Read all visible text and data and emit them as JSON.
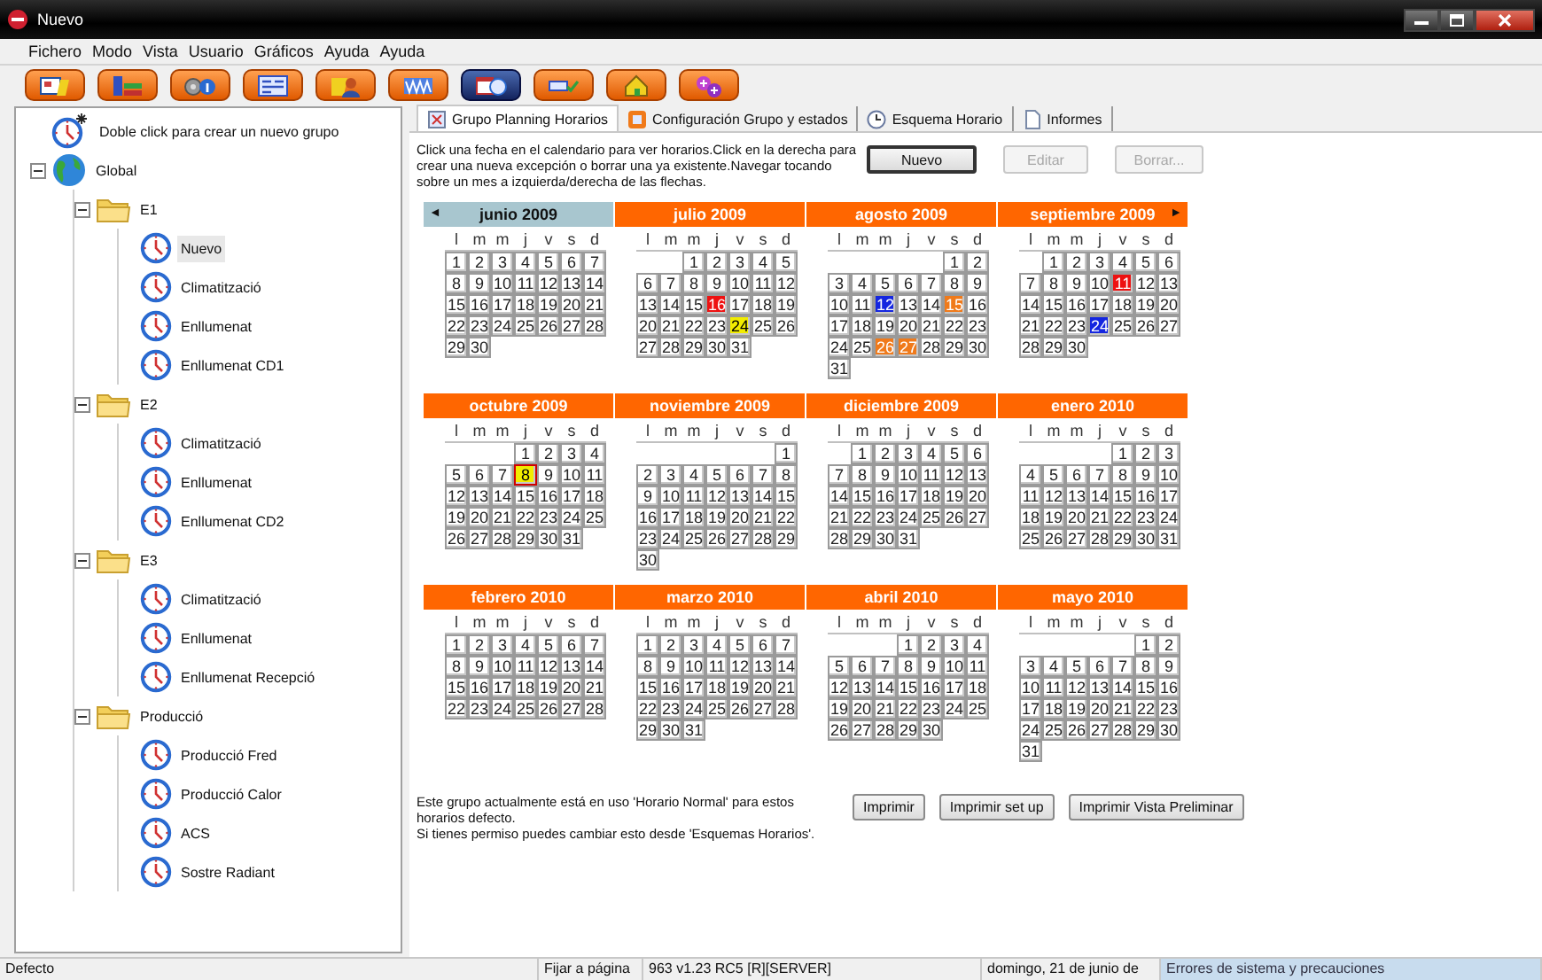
{
  "window": {
    "title": "Nuevo"
  },
  "menu": [
    "Fichero",
    "Modo",
    "Vista",
    "Usuario",
    "Gráficos",
    "Ayuda",
    "Ayuda"
  ],
  "toolbar": [
    {
      "selected": false
    },
    {
      "selected": false
    },
    {
      "selected": false
    },
    {
      "selected": false
    },
    {
      "selected": false
    },
    {
      "selected": false
    },
    {
      "selected": true
    },
    {
      "selected": false
    },
    {
      "selected": false
    },
    {
      "selected": false
    }
  ],
  "tree": {
    "items": [
      {
        "label": "Doble click para crear un nuevo grupo",
        "kind": "new",
        "selected": false
      },
      {
        "label": "Global",
        "kind": "globe",
        "selected": false,
        "expanded": true,
        "children": [
          {
            "label": "E1",
            "kind": "folder",
            "selected": false,
            "expanded": true,
            "children": [
              {
                "label": "Nuevo",
                "kind": "schedule",
                "selected": true
              },
              {
                "label": "Climatització",
                "kind": "schedule",
                "selected": false
              },
              {
                "label": "Enllumenat",
                "kind": "schedule",
                "selected": false
              },
              {
                "label": "Enllumenat CD1",
                "kind": "schedule",
                "selected": false
              }
            ]
          },
          {
            "label": "E2",
            "kind": "folder",
            "selected": false,
            "expanded": true,
            "children": [
              {
                "label": "Climatització",
                "kind": "schedule",
                "selected": false
              },
              {
                "label": "Enllumenat",
                "kind": "schedule",
                "selected": false
              },
              {
                "label": "Enllumenat CD2",
                "kind": "schedule",
                "selected": false
              }
            ]
          },
          {
            "label": "E3",
            "kind": "folder",
            "selected": false,
            "expanded": true,
            "children": [
              {
                "label": "Climatització",
                "kind": "schedule",
                "selected": false
              },
              {
                "label": "Enllumenat",
                "kind": "schedule",
                "selected": false
              },
              {
                "label": "Enllumenat Recepció",
                "kind": "schedule",
                "selected": false
              }
            ]
          },
          {
            "label": "Producció",
            "kind": "folder",
            "selected": false,
            "expanded": true,
            "children": [
              {
                "label": "Producció Fred",
                "kind": "schedule",
                "selected": false
              },
              {
                "label": "Producció Calor",
                "kind": "schedule",
                "selected": false
              },
              {
                "label": "ACS",
                "kind": "schedule",
                "selected": false
              },
              {
                "label": "Sostre Radiant",
                "kind": "schedule",
                "selected": false
              }
            ]
          }
        ]
      }
    ]
  },
  "tabs": [
    {
      "label": "Grupo Planning Horarios",
      "selected": true
    },
    {
      "label": "Configuración Grupo y estados",
      "selected": false
    },
    {
      "label": "Esquema Horario",
      "selected": false
    },
    {
      "label": "Informes",
      "selected": false
    }
  ],
  "instructions": "Click una fecha en el calendario para ver horarios.Click en la derecha para crear una nueva excepción o borrar una ya existente.Navegar tocando sobre un mes a izquierda/derecha de las flechas.",
  "actions": [
    {
      "label": "Nuevo",
      "disabled": false
    },
    {
      "label": "Editar",
      "disabled": true
    },
    {
      "label": "Borrar...",
      "disabled": true
    }
  ],
  "calendar": {
    "months": [
      {
        "title": "junio 2009",
        "selected": true,
        "arrow_left": "◄",
        "weekdays": [
          "l",
          "m",
          "m",
          "j",
          "v",
          "s",
          "d"
        ],
        "weeks": [
          [
            "1",
            "2",
            "3",
            "4",
            "5",
            "6",
            "7"
          ],
          [
            "8",
            "9",
            "10",
            "11",
            "12",
            "13",
            "14"
          ],
          [
            "15",
            "16",
            "17",
            "18",
            "19",
            "20",
            "21"
          ],
          [
            "22",
            "23",
            "24",
            "25",
            "26",
            "27",
            "28"
          ],
          [
            "29",
            "30"
          ]
        ]
      },
      {
        "title": "julio 2009",
        "selected": false,
        "weekdays": [
          "l",
          "m",
          "m",
          "j",
          "v",
          "s",
          "d"
        ],
        "weeks": [
          [
            "1",
            "2",
            "3",
            "4",
            "5"
          ],
          [
            "6",
            "7",
            "8",
            "9",
            "10",
            "11",
            "12"
          ],
          [
            "13",
            "14",
            "15",
            {
              "text": "16",
              "color": "#ee1111"
            },
            "17",
            "18",
            "19"
          ],
          [
            "20",
            "21",
            "22",
            "23",
            {
              "text": "24",
              "color": "#f2ec00"
            },
            "25",
            "26"
          ],
          [
            "27",
            "28",
            "29",
            "30",
            "31"
          ]
        ]
      },
      {
        "title": "agosto 2009",
        "selected": false,
        "weekdays": [
          "l",
          "m",
          "m",
          "j",
          "v",
          "s",
          "d"
        ],
        "weeks": [
          [
            "1",
            "2"
          ],
          [
            "3",
            "4",
            "5",
            "6",
            "7",
            "8",
            "9"
          ],
          [
            "10",
            "11",
            {
              "text": "12",
              "color": "#1426e0"
            },
            "13",
            "14",
            {
              "text": "15",
              "color": "#f07a1a"
            },
            "16"
          ],
          [
            "17",
            "18",
            "19",
            "20",
            "21",
            "22",
            "23"
          ],
          [
            "24",
            "25",
            {
              "text": "26",
              "color": "#f07a1a"
            },
            {
              "text": "27",
              "color": "#f07a1a"
            },
            "28",
            "29",
            "30"
          ],
          [
            "31"
          ]
        ]
      },
      {
        "title": "septiembre 2009",
        "selected": false,
        "arrow_right": "►",
        "weekdays": [
          "l",
          "m",
          "m",
          "j",
          "v",
          "s",
          "d"
        ],
        "weeks": [
          [
            "1",
            "2",
            "3",
            "4",
            "5",
            "6"
          ],
          [
            "7",
            "8",
            "9",
            "10",
            {
              "text": "11",
              "color": "#ee1111"
            },
            "12",
            "13"
          ],
          [
            "14",
            "15",
            "16",
            "17",
            "18",
            "19",
            "20"
          ],
          [
            "21",
            "22",
            "23",
            {
              "text": "24",
              "color": "#1426e0"
            },
            "25",
            "26",
            "27"
          ],
          [
            "28",
            "29",
            "30"
          ]
        ]
      },
      {
        "title": "octubre 2009",
        "selected": false,
        "weekdays": [
          "l",
          "m",
          "m",
          "j",
          "v",
          "s",
          "d"
        ],
        "weeks": [
          [
            "1",
            "2",
            "3",
            "4"
          ],
          [
            "5",
            "6",
            "7",
            {
              "text": "8",
              "color": "#f2ec00",
              "outlined": true
            },
            "9",
            "10",
            "11"
          ],
          [
            "12",
            "13",
            "14",
            "15",
            "16",
            "17",
            "18"
          ],
          [
            "19",
            "20",
            "21",
            "22",
            "23",
            "24",
            "25"
          ],
          [
            "26",
            "27",
            "28",
            "29",
            "30",
            "31"
          ]
        ]
      },
      {
        "title": "noviembre 2009",
        "selected": false,
        "weekdays": [
          "l",
          "m",
          "m",
          "j",
          "v",
          "s",
          "d"
        ],
        "weeks": [
          [
            "1"
          ],
          [
            "2",
            "3",
            "4",
            "5",
            "6",
            "7",
            "8"
          ],
          [
            "9",
            "10",
            "11",
            "12",
            "13",
            "14",
            "15"
          ],
          [
            "16",
            "17",
            "18",
            "19",
            "20",
            "21",
            "22"
          ],
          [
            "23",
            "24",
            "25",
            "26",
            "27",
            "28",
            "29"
          ],
          [
            "30"
          ]
        ]
      },
      {
        "title": "diciembre 2009",
        "selected": false,
        "weekdays": [
          "l",
          "m",
          "m",
          "j",
          "v",
          "s",
          "d"
        ],
        "weeks": [
          [
            "1",
            "2",
            "3",
            "4",
            "5",
            "6"
          ],
          [
            "7",
            "8",
            "9",
            "10",
            "11",
            "12",
            "13"
          ],
          [
            "14",
            "15",
            "16",
            "17",
            "18",
            "19",
            "20"
          ],
          [
            "21",
            "22",
            "23",
            "24",
            "25",
            "26",
            "27"
          ],
          [
            "28",
            "29",
            "30",
            "31"
          ]
        ]
      },
      {
        "title": "enero 2010",
        "selected": false,
        "weekdays": [
          "l",
          "m",
          "m",
          "j",
          "v",
          "s",
          "d"
        ],
        "weeks": [
          [
            "1",
            "2",
            "3"
          ],
          [
            "4",
            "5",
            "6",
            "7",
            "8",
            "9",
            "10"
          ],
          [
            "11",
            "12",
            "13",
            "14",
            "15",
            "16",
            "17"
          ],
          [
            "18",
            "19",
            "20",
            "21",
            "22",
            "23",
            "24"
          ],
          [
            "25",
            "26",
            "27",
            "28",
            "29",
            "30",
            "31"
          ]
        ]
      },
      {
        "title": "febrero 2010",
        "selected": false,
        "weekdays": [
          "l",
          "m",
          "m",
          "j",
          "v",
          "s",
          "d"
        ],
        "weeks": [
          [
            "1",
            "2",
            "3",
            "4",
            "5",
            "6",
            "7"
          ],
          [
            "8",
            "9",
            "10",
            "11",
            "12",
            "13",
            "14"
          ],
          [
            "15",
            "16",
            "17",
            "18",
            "19",
            "20",
            "21"
          ],
          [
            "22",
            "23",
            "24",
            "25",
            "26",
            "27",
            "28"
          ]
        ]
      },
      {
        "title": "marzo 2010",
        "selected": false,
        "weekdays": [
          "l",
          "m",
          "m",
          "j",
          "v",
          "s",
          "d"
        ],
        "weeks": [
          [
            "1",
            "2",
            "3",
            "4",
            "5",
            "6",
            "7"
          ],
          [
            "8",
            "9",
            "10",
            "11",
            "12",
            "13",
            "14"
          ],
          [
            "15",
            "16",
            "17",
            "18",
            "19",
            "20",
            "21"
          ],
          [
            "22",
            "23",
            "24",
            "25",
            "26",
            "27",
            "28"
          ],
          [
            "29",
            "30",
            "31"
          ]
        ]
      },
      {
        "title": "abril 2010",
        "selected": false,
        "weekdays": [
          "l",
          "m",
          "m",
          "j",
          "v",
          "s",
          "d"
        ],
        "weeks": [
          [
            "1",
            "2",
            "3",
            "4"
          ],
          [
            "5",
            "6",
            "7",
            "8",
            "9",
            "10",
            "11"
          ],
          [
            "12",
            "13",
            "14",
            "15",
            "16",
            "17",
            "18"
          ],
          [
            "19",
            "20",
            "21",
            "22",
            "23",
            "24",
            "25"
          ],
          [
            "26",
            "27",
            "28",
            "29",
            "30"
          ]
        ]
      },
      {
        "title": "mayo 2010",
        "selected": false,
        "weekdays": [
          "l",
          "m",
          "m",
          "j",
          "v",
          "s",
          "d"
        ],
        "weeks": [
          [
            "1",
            "2"
          ],
          [
            "3",
            "4",
            "5",
            "6",
            "7",
            "8",
            "9"
          ],
          [
            "10",
            "11",
            "12",
            "13",
            "14",
            "15",
            "16"
          ],
          [
            "17",
            "18",
            "19",
            "20",
            "21",
            "22",
            "23"
          ],
          [
            "24",
            "25",
            "26",
            "27",
            "28",
            "29",
            "30"
          ],
          [
            "31"
          ]
        ]
      }
    ]
  },
  "notice": [
    "Este grupo actualmente está en uso 'Horario Normal' para estos horarios defecto.",
    "Si tienes permiso puedes cambiar esto desde 'Esquemas Horarios'."
  ],
  "print_buttons": [
    "Imprimir",
    "Imprimir set up",
    "Imprimir Vista Preliminar"
  ],
  "status_bar": [
    "Defecto",
    "Fijar a página",
    "963 v1.23 RC5 [R][SERVER]",
    "domingo, 21 de junio de",
    "Errores de sistema y precauciones"
  ]
}
